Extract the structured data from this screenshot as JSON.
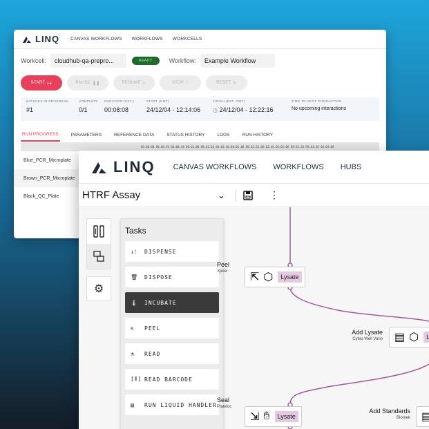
{
  "back_window": {
    "brand": "LINQ",
    "nav": [
      "CANVAS WORKFLOWS",
      "WORKFLOWS",
      "WORKCELLS"
    ],
    "workcell_label": "Workcell:",
    "workcell_value": "cloudhub-qa-prepro...",
    "status_badge": "READY",
    "workflow_label": "Workflow:",
    "workflow_value": "Example Workflow",
    "buttons": {
      "start": "START",
      "pause": "PAUSE",
      "resume": "RESUME",
      "stop": "STOP",
      "reset": "RESET"
    },
    "info": [
      {
        "header": "BATCHES IN PROGRESS",
        "value": "#1"
      },
      {
        "header": "COMPLETE",
        "value": "0/1"
      },
      {
        "header": "DURATION (EST.)",
        "value": "00:08:08"
      },
      {
        "header": "START (GMT)",
        "value": "24/12/04 - 12:14:06"
      },
      {
        "header": "FINISH (EST. GMT)",
        "value": "24/12/04 - 12:22:16"
      },
      {
        "header": "TIME TO NEXT INTERACTION",
        "value": "No upcoming interactions"
      }
    ],
    "tabs": [
      "RUN PROGRESS",
      "PARAMETERS",
      "REFERENCE DATA",
      "STATUS HISTORY",
      "LOGS",
      "RUN HISTORY"
    ],
    "timeline": "00:00:00  00:00:20  00:00:40  00:01:00  00:01:20  00:01:40  00:02:00  00:02:20  00:02:40  00:03:00  00:03:20  00:03:40  00:04:00",
    "plates": [
      "Blue_PCR_Microplate",
      "Brown_PCR_Microplate",
      "Black_QC_Plate"
    ]
  },
  "front_window": {
    "brand": "LINQ",
    "nav": [
      "CANVAS WORKFLOWS",
      "WORKFLOWS",
      "HUBS"
    ],
    "workflow_title": "HTRF Assay",
    "tasks_title": "Tasks",
    "tasks": [
      {
        "label": "DISPENSE",
        "icon": "dispense-icon"
      },
      {
        "label": "DISPOSE",
        "icon": "trash-icon"
      },
      {
        "label": "INCUBATE",
        "icon": "thermometer-icon"
      },
      {
        "label": "PEEL",
        "icon": "peel-icon"
      },
      {
        "label": "READ",
        "icon": "microscope-icon"
      },
      {
        "label": "READ BARCODE",
        "icon": "barcode-icon"
      },
      {
        "label": "RUN LIQUID HANDLER",
        "icon": "liquid-handler-icon"
      }
    ],
    "active_task_index": 2,
    "nodes": {
      "peel": {
        "name": "Peel",
        "device": "Xpeel",
        "tag": "Lysate"
      },
      "add_lysate": {
        "name": "Add Lysate",
        "device": "Cybio Well Vario",
        "tag": "L"
      },
      "seal": {
        "name": "Seal",
        "device": "Plateloc",
        "tag": "Lysate"
      },
      "add_standards": {
        "name": "Add Standards",
        "device": "Biomek"
      }
    },
    "accent_color": "#a0589a"
  }
}
